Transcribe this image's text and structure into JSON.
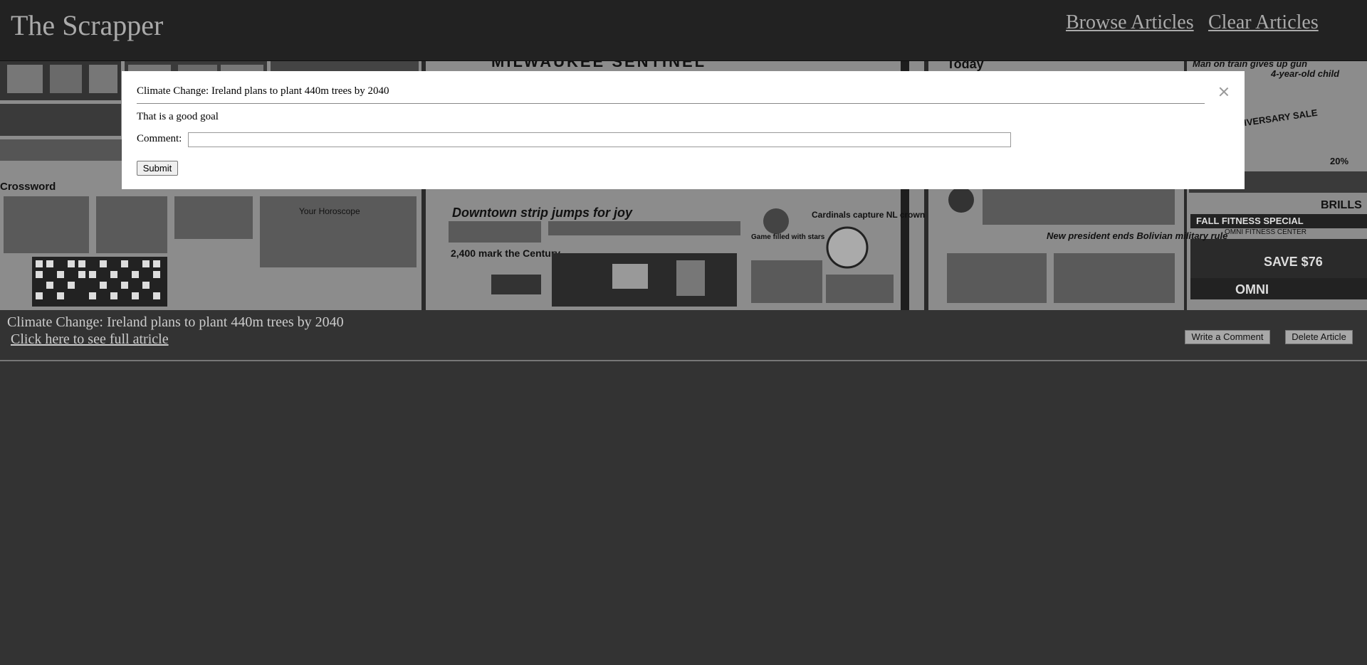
{
  "header": {
    "title": "The Scrapper",
    "nav": {
      "browse_label": "Browse Articles",
      "clear_label": "Clear Articles"
    }
  },
  "hero": {
    "image": "newspaper-collage",
    "headlines": [
      "MILWAUKEE SENTINEL",
      "Today",
      "Man on train gives up gun",
      "4-year-old child",
      "ANNIVERSARY SALE",
      "20%",
      "Crossword",
      "Your Horoscope",
      "Downtown strip jumps for joy",
      "Cardinals capture NL crown",
      "Game filled with stars",
      "2,400 mark the Century",
      "New president ends Bolivian military rule",
      "BRILLS",
      "FALL FITNESS SPECIAL",
      "OMNI FITNESS CENTER",
      "SAVE $76",
      "OMNI"
    ]
  },
  "article": {
    "title": "Climate Change: Ireland plans to plant 440m trees by 2040",
    "link_label": "Click here to see full atricle",
    "write_comment_label": "Write a Comment",
    "delete_label": "Delete Article"
  },
  "modal": {
    "title": "Climate Change: Ireland plans to plant 440m trees by 2040",
    "close_icon": "close-icon",
    "existing_comment": "That is a good goal",
    "comment_label": "Comment:",
    "comment_value": "",
    "submit_label": "Submit"
  }
}
